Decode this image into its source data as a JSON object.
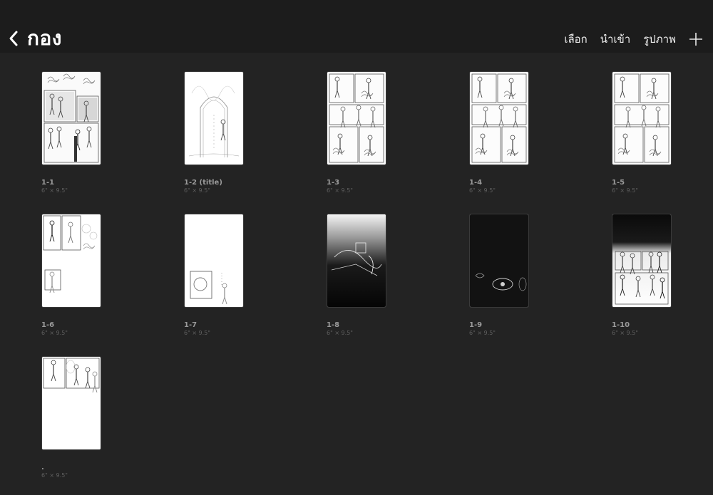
{
  "header": {
    "back_label": "กอง",
    "actions": {
      "select": "เลือก",
      "import": "นำเข้า",
      "photo": "รูปภาพ"
    }
  },
  "artworks": [
    {
      "name": "1-1",
      "size": "6\" × 9.5\"",
      "style": "sketch-dense"
    },
    {
      "name": "1-2 (title)",
      "size": "6\" × 9.5\"",
      "style": "sketch-arch"
    },
    {
      "name": "1-3",
      "size": "6\" × 9.5\"",
      "style": "sketch-panels"
    },
    {
      "name": "1-4",
      "size": "6\" × 9.5\"",
      "style": "sketch-panels"
    },
    {
      "name": "1-5",
      "size": "6\" × 9.5\"",
      "style": "sketch-panels"
    },
    {
      "name": "1-6",
      "size": "6\" × 9.5\"",
      "style": "sketch-sparse"
    },
    {
      "name": "1-7",
      "size": "6\" × 9.5\"",
      "style": "sketch-sparse-bottom"
    },
    {
      "name": "1-8",
      "size": "6\" × 9.5\"",
      "style": "dark-gradient"
    },
    {
      "name": "1-9",
      "size": "6\" × 9.5\"",
      "style": "dark"
    },
    {
      "name": "1-10",
      "size": "6\" × 9.5\"",
      "style": "dark-top"
    },
    {
      "name": ".",
      "size": "6\" × 9.5\"",
      "style": "sketch-top"
    }
  ]
}
